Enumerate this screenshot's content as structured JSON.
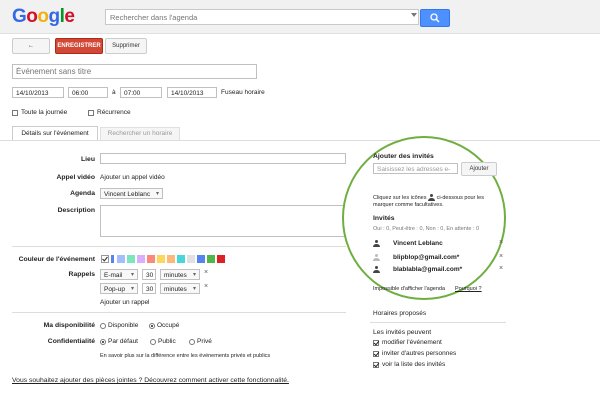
{
  "header": {
    "logo_letters": [
      {
        "ch": "G",
        "color": "#3369e8"
      },
      {
        "ch": "o",
        "color": "#d50f25"
      },
      {
        "ch": "o",
        "color": "#eeb211"
      },
      {
        "ch": "g",
        "color": "#3369e8"
      },
      {
        "ch": "l",
        "color": "#009925"
      },
      {
        "ch": "e",
        "color": "#d50f25"
      }
    ],
    "search_placeholder": "Rechercher dans l'agenda"
  },
  "toolbar": {
    "back_label": "←",
    "save_label": "ENREGISTRER",
    "delete_label": "Supprimer"
  },
  "event": {
    "title_placeholder": "Événement sans titre",
    "start_date": "14/10/2013",
    "start_time": "06:00",
    "to_label": "à",
    "end_time": "07:00",
    "end_date": "14/10/2013",
    "timezone_link": "Fuseau horaire",
    "all_day_label": "Toute la journée",
    "recurrence_label": "Récurrence"
  },
  "tabs": {
    "details": "Détails sur l'événement",
    "find_time": "Rechercher un horaire"
  },
  "form": {
    "lieu_label": "Lieu",
    "video_label": "Appel vidéo",
    "video_link": "Ajouter un appel vidéo",
    "agenda_label": "Agenda",
    "agenda_value": "Vincent Leblanc",
    "description_label": "Description",
    "color_label": "Couleur de l'événement",
    "colors": [
      "#a4bdfc",
      "#7ae7bf",
      "#dbadff",
      "#ff887c",
      "#fbd75b",
      "#ffb878",
      "#46d6db",
      "#e1e1e1",
      "#5484ed",
      "#51b749",
      "#dc2127"
    ],
    "reminders_label": "Rappels",
    "reminders": [
      {
        "type": "E-mail",
        "value": "30",
        "unit": "minutes"
      },
      {
        "type": "Pop-up",
        "value": "30",
        "unit": "minutes"
      }
    ],
    "remove_glyph": "×",
    "add_reminder_link": "Ajouter un rappel",
    "availability_label": "Ma disponibilité",
    "availability_options": [
      "Disponible",
      "Occupé"
    ],
    "privacy_label": "Confidentialité",
    "privacy_options": [
      "Par défaut",
      "Public",
      "Privé"
    ],
    "privacy_help": "En savoir plus sur la différence entre les événements privés et publics",
    "attachments_text": "Vous souhaitez ajouter des pièces jointes ? Découvrez comment activer cette fonctionnalité."
  },
  "guests": {
    "add_title": "Ajouter des invités",
    "input_placeholder": "Saisissez les adresses e-",
    "add_button": "Ajouter",
    "hint_before": "Cliquez sur les icônes",
    "hint_after": "ci-dessous pour les marquer comme facultatives.",
    "invites_title": "Invités",
    "rsvp_summary": "Oui : 0, Peut-être : 0, Non : 0, En attente : 0",
    "list": [
      {
        "name": "Vincent Leblanc",
        "organizer": true
      },
      {
        "name": "blipblop@gmail.com*",
        "organizer": false
      },
      {
        "name": "blablabla@gmail.com*",
        "organizer": false
      }
    ],
    "cannot_show": "Impossible d'afficher l'agenda",
    "why_link": "Pourquoi ?",
    "suggested_times": "Horaires proposés",
    "can_title": "Les invités peuvent",
    "permissions": [
      {
        "label": "modifier l'événement",
        "checked": true
      },
      {
        "label": "inviter d'autres personnes",
        "checked": true
      },
      {
        "label": "voir la liste des invités",
        "checked": true
      }
    ]
  },
  "accent": {
    "primary_blue": "#4d90fe",
    "link_blue": "#1155cc",
    "save_red": "#d14836",
    "highlight_green": "#6fae3f"
  }
}
